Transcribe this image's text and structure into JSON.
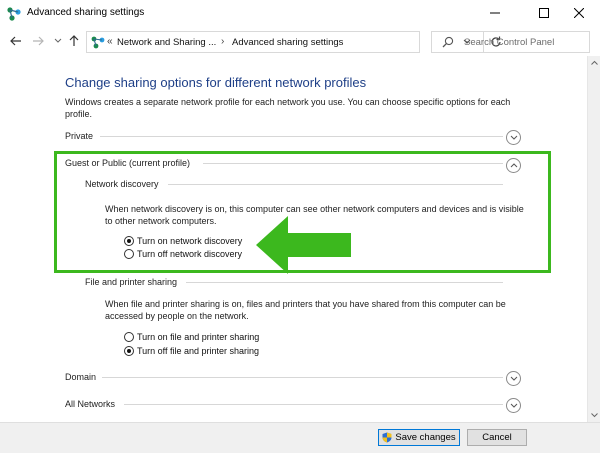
{
  "window": {
    "title": "Advanced sharing settings"
  },
  "address": {
    "crumbs": [
      "Network and Sharing ...",
      "Advanced sharing settings"
    ],
    "search_placeholder": "Search Control Panel"
  },
  "page": {
    "heading": "Change sharing options for different network profiles",
    "intro": "Windows creates a separate network profile for each network you use. You can choose specific options for each profile."
  },
  "profiles": {
    "private": "Private",
    "guest_public": "Guest or Public (current profile)",
    "domain": "Domain",
    "all_networks": "All Networks"
  },
  "network_discovery": {
    "title": "Network discovery",
    "description": "When network discovery is on, this computer can see other network computers and devices and is visible to other network computers.",
    "options": [
      "Turn on network discovery",
      "Turn off network discovery"
    ],
    "selected": 0
  },
  "file_printer_sharing": {
    "title": "File and printer sharing",
    "description": "When file and printer sharing is on, files and printers that you have shared from this computer can be accessed by people on the network.",
    "options": [
      "Turn on file and printer sharing",
      "Turn off file and printer sharing"
    ],
    "selected": 1
  },
  "footer": {
    "save_label": "Save changes",
    "cancel_label": "Cancel"
  },
  "colors": {
    "highlight": "#3cb81e",
    "heading": "#1e3f87"
  }
}
